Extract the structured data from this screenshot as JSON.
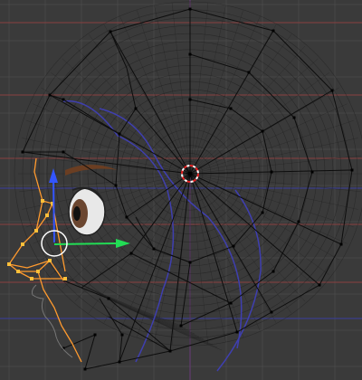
{
  "viewport": {
    "name": "3d-viewport-side-view",
    "colors": {
      "background": "#3a3a3a",
      "grid": "#474747",
      "axis_red_line": "#8a4040",
      "axis_blue_line": "#3b3f8c",
      "axis_vertical": "#6a3a7a",
      "cage_wire": "#0d0d0d",
      "cage_vertex": "#000000",
      "dense_mesh": "#1e1e1e",
      "guide_curve": "#3f3fb0",
      "selected_edge": "#ff9a2e",
      "selected_vertex": "#ffbf3a",
      "cursor_red": "#e82020",
      "cursor_white": "#ffffff",
      "gizmo_green": "#22dd55",
      "gizmo_blue": "#3355ff",
      "eye_iris": "#6b4630",
      "eyebrow": "#6b3e22"
    },
    "icons": {
      "cursor": "3d-cursor-icon",
      "manipulator": "transform-manipulator-icon",
      "pivot": "pivot-circle-icon"
    }
  }
}
